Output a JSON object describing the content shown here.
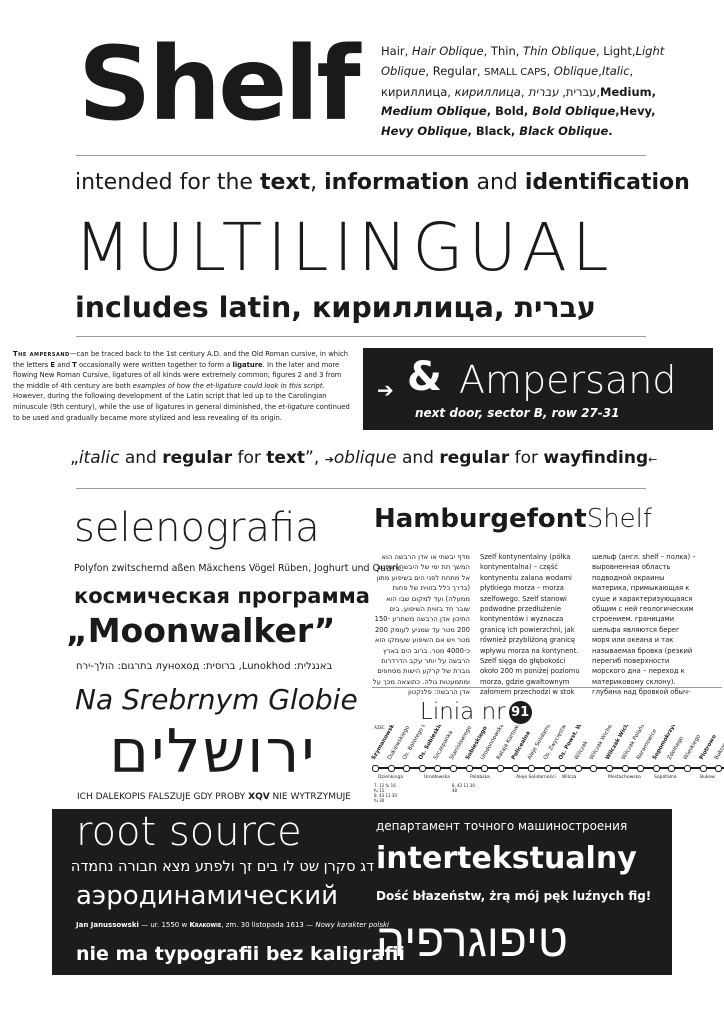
{
  "title": "Shelf",
  "styles": [
    {
      "t": "Hair, ",
      "i": false,
      "b": false
    },
    {
      "t": "Hair Oblique",
      "i": true,
      "b": false
    },
    {
      "t": ", Thin, ",
      "i": false,
      "b": false
    },
    {
      "t": "Thin Oblique",
      "i": true,
      "b": false
    },
    {
      "t": ", Light,",
      "i": false,
      "b": false
    },
    {
      "t": "Light Oblique",
      "i": true,
      "b": false
    },
    {
      "t": ", Regular, ",
      "i": false,
      "b": false
    },
    {
      "t": "SMALL CAPS",
      "i": false,
      "b": false
    },
    {
      "t": ", ",
      "i": false,
      "b": false
    },
    {
      "t": "Oblique",
      "i": true,
      "b": false
    },
    {
      "t": ",",
      "i": false,
      "b": false
    },
    {
      "t": "Italic",
      "i": true,
      "b": false
    },
    {
      "t": ", кириллица, ",
      "i": false,
      "b": false
    },
    {
      "t": "кириллица",
      "i": true,
      "b": false
    },
    {
      "t": ", עברית, ",
      "i": false,
      "b": false
    },
    {
      "t": "עברית",
      "i": true,
      "b": false
    },
    {
      "t": ",",
      "i": false,
      "b": false
    },
    {
      "t": "Medium, ",
      "i": false,
      "b": true
    },
    {
      "t": "Medium Oblique",
      "i": true,
      "b": true
    },
    {
      "t": ", Bold, ",
      "i": false,
      "b": true
    },
    {
      "t": "Bold Oblique",
      "i": true,
      "b": true
    },
    {
      "t": ",",
      "i": false,
      "b": true
    },
    {
      "t": "Hevy, ",
      "i": false,
      "b": true
    },
    {
      "t": "Hevy Oblique",
      "i": true,
      "b": true
    },
    {
      "t": ", Black, ",
      "i": false,
      "b": true
    },
    {
      "t": "Black Oblique",
      "i": true,
      "b": true
    },
    {
      "t": ".",
      "i": false,
      "b": true
    }
  ],
  "intended": {
    "a": "intended for the ",
    "b": "text",
    "c": ", ",
    "d": "information",
    "e": " and ",
    "f": "identification"
  },
  "multilingual": "MULTILINGUAL",
  "includes": "includes latin, кириллица, עברית",
  "ampersand_text": {
    "sc": "The ampersand",
    "p1": "—can be traced back to the 1st century A.D. and the Old Roman cursive, in which the letters ",
    "e": "E",
    "p2": " and ",
    "t": "T",
    "p3": " occasionally were written together to form a ",
    "lig": "ligature",
    "p4": ". In the later and more flowing New Roman Cursive, ligatures of all kinds were extremely common; figures 2 and 3 from the middle of 4th century are both ",
    "ex": "examples of how the et-ligature could look in this script",
    "p5": ". However, during the following development of the Latin script that led up to the Carolingian minuscule (9th century), while the use of ligatures in general diminished, the ",
    "etl": "et-ligature",
    "p6": " continued to be used and gradually became more stylized and less revealing of its origin."
  },
  "ampbox": {
    "arrow": "➔",
    "amp": "&",
    "word": "Ampersand",
    "sub": "next door, sector B, row 27-31"
  },
  "italic_line": {
    "a": "„",
    "b": "italic",
    "c": " and ",
    "d": "regular",
    "e": " for ",
    "f": "text",
    "g": "”, ",
    "h": "➔",
    "i": "oblique",
    "j": " and ",
    "k": "regular",
    "l": " for ",
    "m": "wayfinding",
    "n": "←"
  },
  "selenografia": "selenografia",
  "polyfon": "Polyfon zwitschernd aßen Mäxchens Vögel Rüben, Joghurt und Quark.",
  "kosm": "космическая программа",
  "moonwalker": "„Moonwalker”",
  "heb_line": "באנגלית: Lunokhod, ברוסית: луноход בתרגום: הולך-ירח",
  "na_srebrnym": "Na Srebrnym Globie",
  "yerushalaim": "ירושלים",
  "ichdal": {
    "a": "ICH DALEKOPIS FALSZUJE GDY PROBY ",
    "b": "XQV",
    "c": " NIE WYTRZYMUJE"
  },
  "hamburgefont": {
    "a": "Hamburgefont",
    "b": "Shelf"
  },
  "col_heb": "מדף יבשתי או אדן הרבשה הוא המשך תת ימי של היבשה הנחשב אל מתחת לפני הים בשיפוע מתון (בדרך כלל בזווית של פחות ממעלה) ועד למקום שבו הוא שובר חד בזווית השיפוע. בים התיכון אדן הרבשה משתרע 150-200 מטר עד שמגיע לעומק 200 מטר ויש אם השיפוע שעומקו הוא כ-4000 מטר. ברוב הים בארץ הרבשה על יותר עקב הדרדרות גוברת של קרקע הישות מסחפים ומתמעטות גולה. כתוצאה מכך על אדן הרבשה: פלנקטון",
  "col_pl": "Szelf kontynentalny (półka kontynentalna) – część kontynentu zalana wodami płytkiego morza – morza szelfowego. Szelf stanowi podwodne przedłużenie kontynentów i wyznacza granicę ich powierzchni, jak również przybliżoną granicę wpływu morza na kontynent. Szelf sięga do głębokości około 200 m poniżej poziomu morza, gdzie gwałtownym załomem przechodzi w stok",
  "col_ru": "шельф (англ. shelf – полка) – выровненная область подводной окраины материка, примыкающая к суше и характеризующаяся общим с ней геологическим строением. границами шельфа являются берег моря или океана и так называемая бровка (резкий перегиб поверхности морского дна – переход к материковому склону). глубина над бровкой обыч-",
  "linia": {
    "label": "Linia nr",
    "num": "91"
  },
  "route_top": "AZEC",
  "stops": [
    "Szymanowskiego",
    "Dukiewskiego",
    "Os. Batorego II",
    "Os. Sobieskiego II",
    "Szczepanka",
    "Stanisławiego",
    "Sobieskiego",
    "Urodonnowska",
    "Rataja Kartowska",
    "Policealna",
    "Aleje Solidarności",
    "Os. Zwycięstwa",
    "Os. Powst. W-wy",
    "Wilczak",
    "Wilczak Wicheńskie",
    "Wilczak Wiclaw",
    "Wilczak Polańskie",
    "Naramowice",
    "Sopomokrzynska",
    "Zdolnego",
    "Wieskiego",
    "Piotrowo",
    "Bukowska"
  ],
  "stop_labels": [
    "Dzieńkinga",
    "Urodłowska",
    "Polabska",
    "Aleje Solidarności",
    "Wilcza",
    "Mostachowska",
    "Sopótalna",
    "Bukow"
  ],
  "route_times": [
    "7, 12 fu 16",
    "fu 15",
    "8, 43 11 30",
    "fu 30"
  ],
  "route_times2": [
    "8, 43 11 30",
    "48"
  ],
  "bottom": {
    "root": "root source",
    "heb": "דג סקרן שט לו בים זך ולפתע מצא חבורה נחמדה",
    "aero": "аэродинамический",
    "jan": {
      "a": "Jan Janussowski",
      "b": " — ur. 1550 w ",
      "c": "Krakowie",
      "d": ", zm. 30 listopada 1613 — ",
      "e": "Nowy karakter polski"
    },
    "nie": "nie ma typografii bez kaligrafii",
    "dep": "департамент точного машиностроения",
    "inter": "intertekstualny",
    "dosc": "Dość błazeństw, żrą mój pęk luźnych fig!",
    "tipo": "טיפוגרפיה"
  }
}
